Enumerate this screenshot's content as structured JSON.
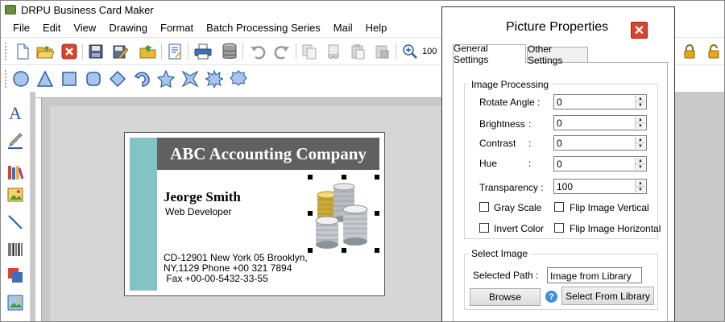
{
  "app": {
    "title": "DRPU Business Card Maker",
    "menu": [
      "File",
      "Edit",
      "View",
      "Drawing",
      "Format",
      "Batch Processing Series",
      "Mail",
      "Help"
    ],
    "zoom_value": "100"
  },
  "toolbar_icons": [
    "new-file-icon",
    "open-folder-icon",
    "close-icon",
    "save-icon",
    "save-as-icon",
    "open-icon",
    "properties-icon",
    "print-icon",
    "database-icon",
    "undo-icon",
    "redo-icon",
    "copy-icon",
    "cut-icon",
    "paste-icon",
    "paste-special-icon",
    "zoom-in-icon",
    "lock-icon",
    "unlock-icon"
  ],
  "shape_icons": [
    "ellipse-icon",
    "triangle-icon",
    "rectangle-icon",
    "rounded-rectangle-icon",
    "diamond-icon",
    "arc-icon",
    "star-icon",
    "four-point-star-icon",
    "burst-icon",
    "seal-icon"
  ],
  "left_tools": [
    "text-tool-icon",
    "pencil-tool-icon",
    "library-tool-icon",
    "image-tool-icon",
    "line-tool-icon",
    "barcode-tool-icon",
    "watermark-tool-icon",
    "picture-library-tool-icon"
  ],
  "card": {
    "company": "ABC Accounting Company",
    "name": "Jeorge Smith",
    "job_title": "Web Developer",
    "address_lines": [
      "CD-12901 New York 05 Brooklyn,",
      "NY,1129 Phone +00 321 7894",
      " Fax +00-00-5432-33-55"
    ],
    "colors": {
      "band": "#82c3c3",
      "header": "#606060"
    }
  },
  "dialog": {
    "title": "Picture Properties",
    "tabs": [
      "General Settings",
      "Other Settings"
    ],
    "active_tab": "General Settings",
    "image_processing": {
      "title": "Image Processing",
      "rotate_label": "Rotate Angle :",
      "rotate_value": "0",
      "brightness_label": "Brightness",
      "brightness_value": "0",
      "contrast_label": "Contrast",
      "contrast_value": "0",
      "hue_label": "Hue",
      "hue_value": "0",
      "transparency_label": "Transparency :",
      "transparency_value": "100",
      "colon": ":"
    },
    "checkboxes": {
      "gray_scale": "Gray Scale",
      "flip_vertical": "Flip Image Vertical",
      "invert_color": "Invert Color",
      "flip_horizontal": "Flip Image Horizontal"
    },
    "select_image": {
      "title": "Select Image",
      "path_label": "Selected Path :",
      "path_value": "Image from Library",
      "browse": "Browse",
      "help": "?",
      "library": "Select From Library"
    },
    "close": "✕"
  }
}
